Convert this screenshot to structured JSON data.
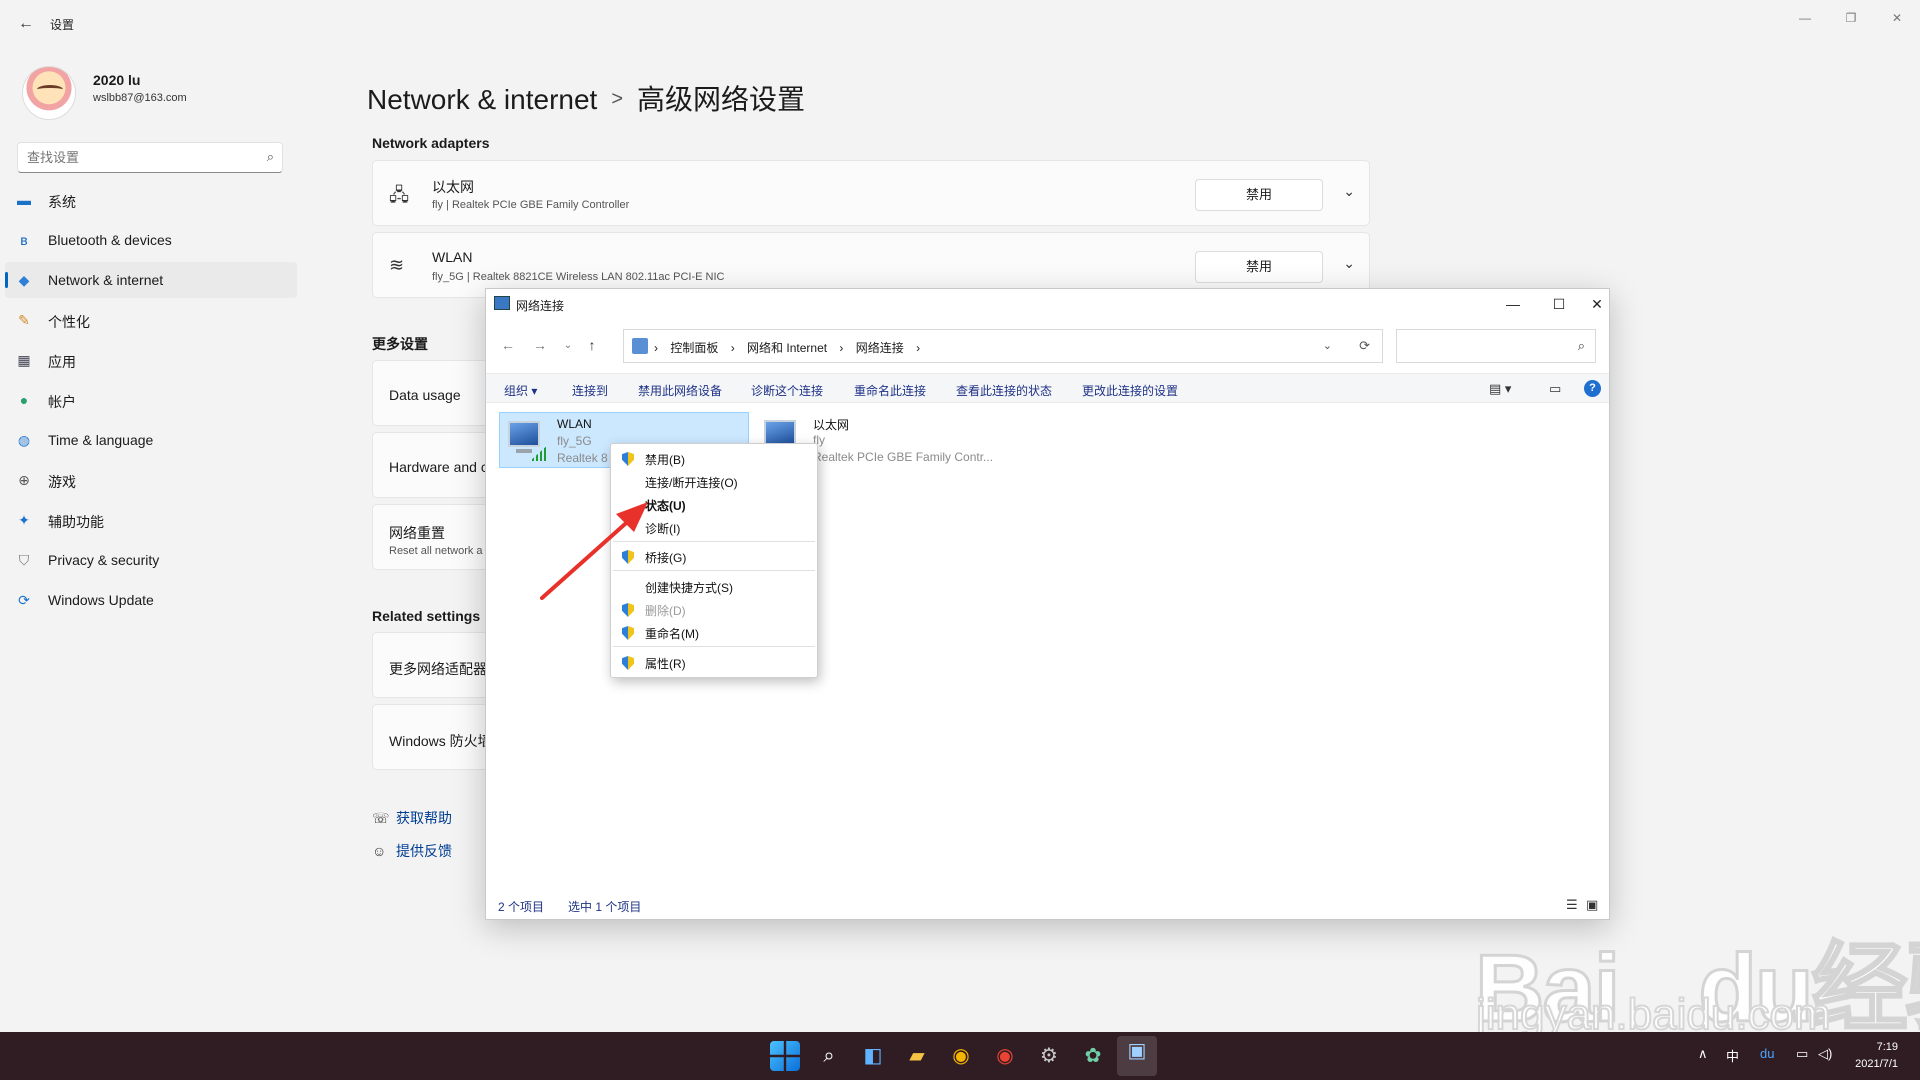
{
  "settings": {
    "app_title": "设置",
    "back_icon": "back-arrow-icon",
    "user": {
      "name": "2020 lu",
      "email": "wslbb87@163.com"
    },
    "search_placeholder": "查找设置",
    "nav": [
      {
        "label": "系统",
        "icon": "monitor-icon"
      },
      {
        "label": "Bluetooth & devices",
        "icon": "bluetooth-icon"
      },
      {
        "label": "Network & internet",
        "icon": "wifi-icon",
        "active": true
      },
      {
        "label": "个性化",
        "icon": "brush-icon"
      },
      {
        "label": "应用",
        "icon": "apps-icon"
      },
      {
        "label": "帐户",
        "icon": "person-icon"
      },
      {
        "label": "Time & language",
        "icon": "globe-clock-icon"
      },
      {
        "label": "游戏",
        "icon": "gamepad-icon"
      },
      {
        "label": "辅助功能",
        "icon": "accessibility-icon"
      },
      {
        "label": "Privacy & security",
        "icon": "shield-icon"
      },
      {
        "label": "Windows Update",
        "icon": "update-icon"
      }
    ],
    "breadcrumb": {
      "parent": "Network & internet",
      "separator": ">",
      "current": "高级网络设置"
    },
    "adapters_title": "Network adapters",
    "adapters": [
      {
        "name": "以太网",
        "detail": "fly | Realtek PCIe GBE Family Controller",
        "button": "禁用"
      },
      {
        "name": "WLAN",
        "detail": "fly_5G | Realtek 8821CE Wireless LAN 802.11ac PCI-E NIC",
        "button": "禁用"
      }
    ],
    "more_settings_title": "更多设置",
    "more_settings": [
      {
        "title": "Data usage",
        "sub": ""
      },
      {
        "title": "Hardware and c",
        "sub": ""
      },
      {
        "title": "网络重置",
        "sub": "Reset all network a"
      }
    ],
    "related_title": "Related settings",
    "related": [
      "更多网络适配器",
      "Windows 防火墙"
    ],
    "help_links": [
      "获取帮助",
      "提供反馈"
    ]
  },
  "explorer": {
    "title": "网络连接",
    "address": [
      "控制面板",
      "网络和 Internet",
      "网络连接"
    ],
    "commands": [
      "组织 ▾",
      "连接到",
      "禁用此网络设备",
      "诊断这个连接",
      "重命名此连接",
      "查看此连接的状态",
      "更改此连接的设置"
    ],
    "items": [
      {
        "name": "WLAN",
        "line1": "fly_5G",
        "line2": "Realtek 8",
        "selected": true
      },
      {
        "name": "以太网",
        "line1": "fly",
        "line2": "Realtek PCIe GBE Family Contr..."
      }
    ],
    "status": {
      "count": "2 个项目",
      "selected": "选中 1 个项目"
    }
  },
  "context_menu": [
    {
      "label": "禁用(B)",
      "shield": true
    },
    {
      "label": "连接/断开连接(O)",
      "shield": false
    },
    {
      "label": "状态(U)",
      "shield": false,
      "bold": true
    },
    {
      "label": "诊断(I)",
      "shield": false
    },
    {
      "label": "桥接(G)",
      "shield": true
    },
    {
      "label": "创建快捷方式(S)",
      "shield": false
    },
    {
      "label": "删除(D)",
      "shield": true,
      "disabled": true
    },
    {
      "label": "重命名(M)",
      "shield": true
    },
    {
      "label": "属性(R)",
      "shield": true
    }
  ],
  "annotation_color": "#e8312a",
  "watermark": {
    "brand": "Baidu经验",
    "url": "jingyan.baidu.com"
  },
  "taskbar": {
    "apps": [
      "start-icon",
      "search-icon",
      "widgets-icon",
      "file-explorer-icon",
      "chrome-icon",
      "chrome-icon",
      "settings-icon",
      "paint-icon",
      "network-connections-icon"
    ],
    "ime": "中",
    "time": "7:19",
    "date": "2021/7/1"
  }
}
